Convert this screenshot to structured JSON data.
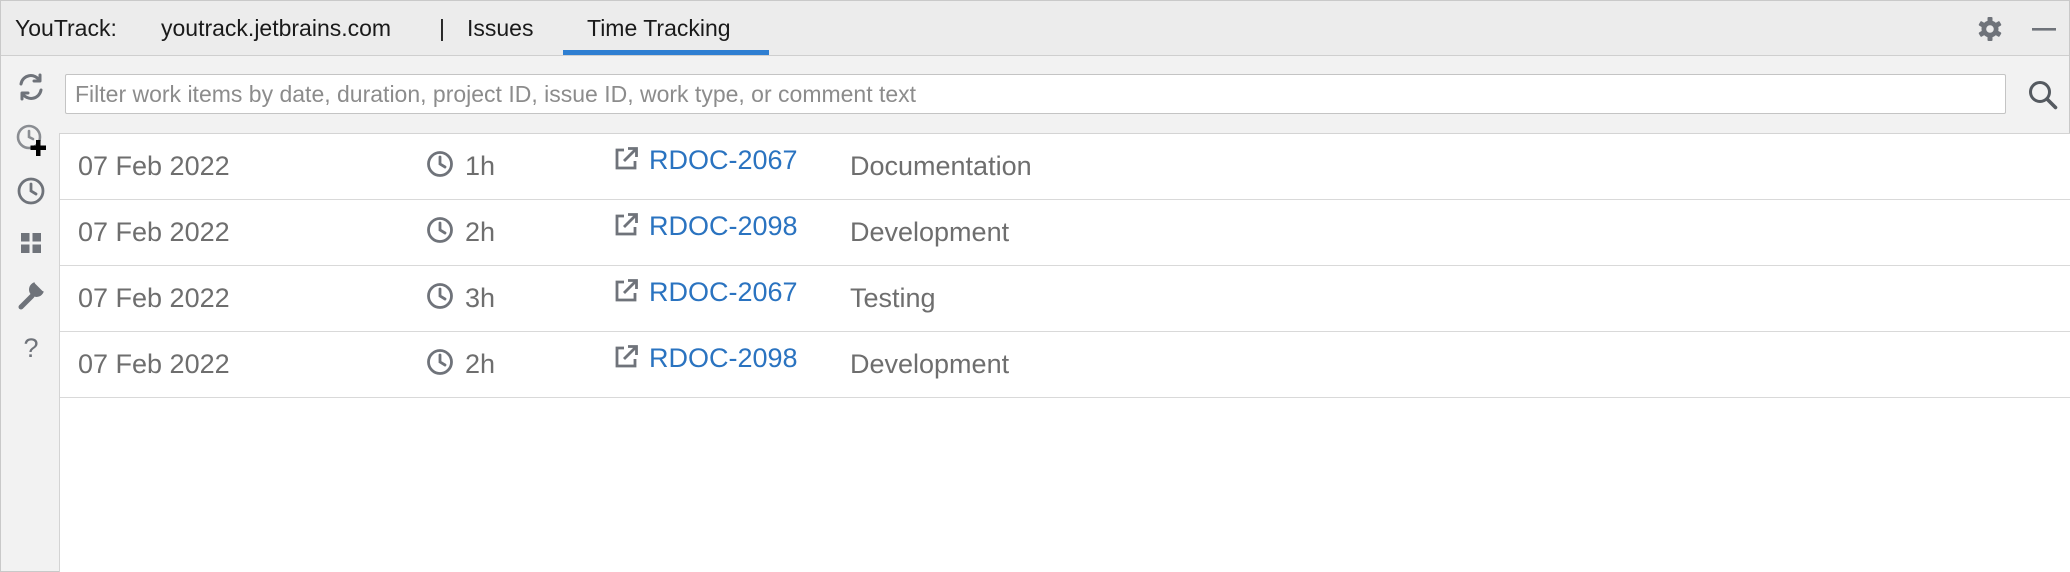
{
  "header": {
    "app_label": "YouTrack:",
    "tabs": [
      {
        "label": "youtrack.jetbrains.com"
      },
      {
        "label": "Issues"
      },
      {
        "label": "Time Tracking",
        "active": true
      }
    ],
    "separator": "|",
    "settings_icon": "gear-icon",
    "minimize_icon": "minimize-icon"
  },
  "toolbar": {
    "items": [
      {
        "icon": "refresh-icon"
      },
      {
        "icon": "add-work-item-icon"
      },
      {
        "icon": "clock-icon"
      },
      {
        "icon": "grid-icon"
      },
      {
        "icon": "wrench-icon"
      },
      {
        "icon": "help-icon",
        "glyph": "?"
      }
    ]
  },
  "search": {
    "placeholder": "Filter work items by date, duration, project ID, issue ID, work type, or comment text",
    "value": "",
    "icon": "search-icon"
  },
  "work_items": [
    {
      "date": "07 Feb 2022",
      "duration": "1h",
      "issue": "RDOC-2067",
      "type": "Documentation"
    },
    {
      "date": "07 Feb 2022",
      "duration": "2h",
      "issue": "RDOC-2098",
      "type": "Development"
    },
    {
      "date": "07 Feb 2022",
      "duration": "3h",
      "issue": "RDOC-2067",
      "type": "Testing"
    },
    {
      "date": "07 Feb 2022",
      "duration": "2h",
      "issue": "RDOC-2098",
      "type": "Development"
    }
  ],
  "colors": {
    "accent": "#2f7fd2",
    "link": "#2a73c0",
    "text_muted": "#6e6e6e",
    "icon_gray": "#6f737a"
  }
}
